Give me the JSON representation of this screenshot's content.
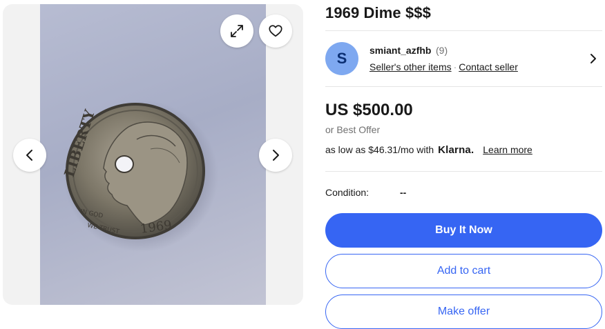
{
  "listing": {
    "title": "1969 Dime $$$"
  },
  "gallery": {
    "image_alt": "1969 dime coin with hole",
    "icons": {
      "expand": "expand-icon",
      "favorite": "heart-icon",
      "previous": "chevron-left-icon",
      "next": "chevron-right-icon"
    }
  },
  "seller": {
    "avatar_initial": "S",
    "name": "smiant_azfhb",
    "feedback_count": "(9)",
    "other_items_link": "Seller's other items",
    "separator": "·",
    "contact_link": "Contact seller"
  },
  "pricing": {
    "price": "US $500.00",
    "best_offer": "or Best Offer",
    "klarna_prefix": "as low as $46.31/mo with",
    "klarna_brand": "Klarna.",
    "learn_more": "Learn more"
  },
  "condition": {
    "label": "Condition:",
    "value": "--"
  },
  "actions": {
    "buy_now": "Buy It Now",
    "add_to_cart": "Add to cart",
    "make_offer": "Make offer"
  },
  "colors": {
    "accent": "#3665f3",
    "avatar": "#7ea8f0"
  }
}
